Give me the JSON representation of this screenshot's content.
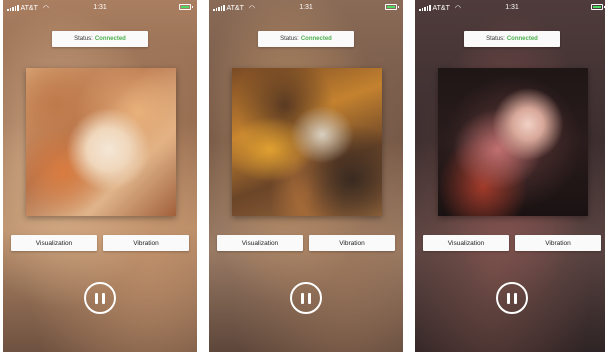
{
  "statusbar": {
    "carrier": "AT&T",
    "time": "1:31"
  },
  "status": {
    "label": "Status:",
    "value": "Connected"
  },
  "buttons": {
    "visualization": "Visualization",
    "vibration": "Vibration"
  },
  "icons": {
    "pause": "pause-icon",
    "wifi": "wifi-icon",
    "battery": "battery-icon",
    "signal": "signal-icon"
  },
  "colors": {
    "connected": "#4caf50",
    "battery": "#4cd964"
  }
}
